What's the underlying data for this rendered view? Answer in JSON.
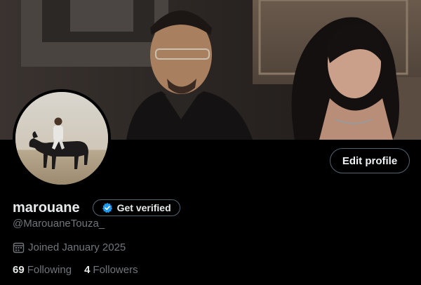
{
  "profile": {
    "display_name": "marouane",
    "handle": "@MarouaneTouza_",
    "joined": "Joined January 2025",
    "edit_label": "Edit profile",
    "verify_label": "Get verified",
    "following_count": "69",
    "following_label": "Following",
    "followers_count": "4",
    "followers_label": "Followers"
  },
  "icons": {
    "verified": "verified-badge-icon",
    "calendar": "calendar-icon"
  },
  "colors": {
    "background": "#000000",
    "text_primary": "#e7e9ea",
    "text_secondary": "#71767b",
    "border": "#536471",
    "verified_blue": "#1d9bf0"
  }
}
